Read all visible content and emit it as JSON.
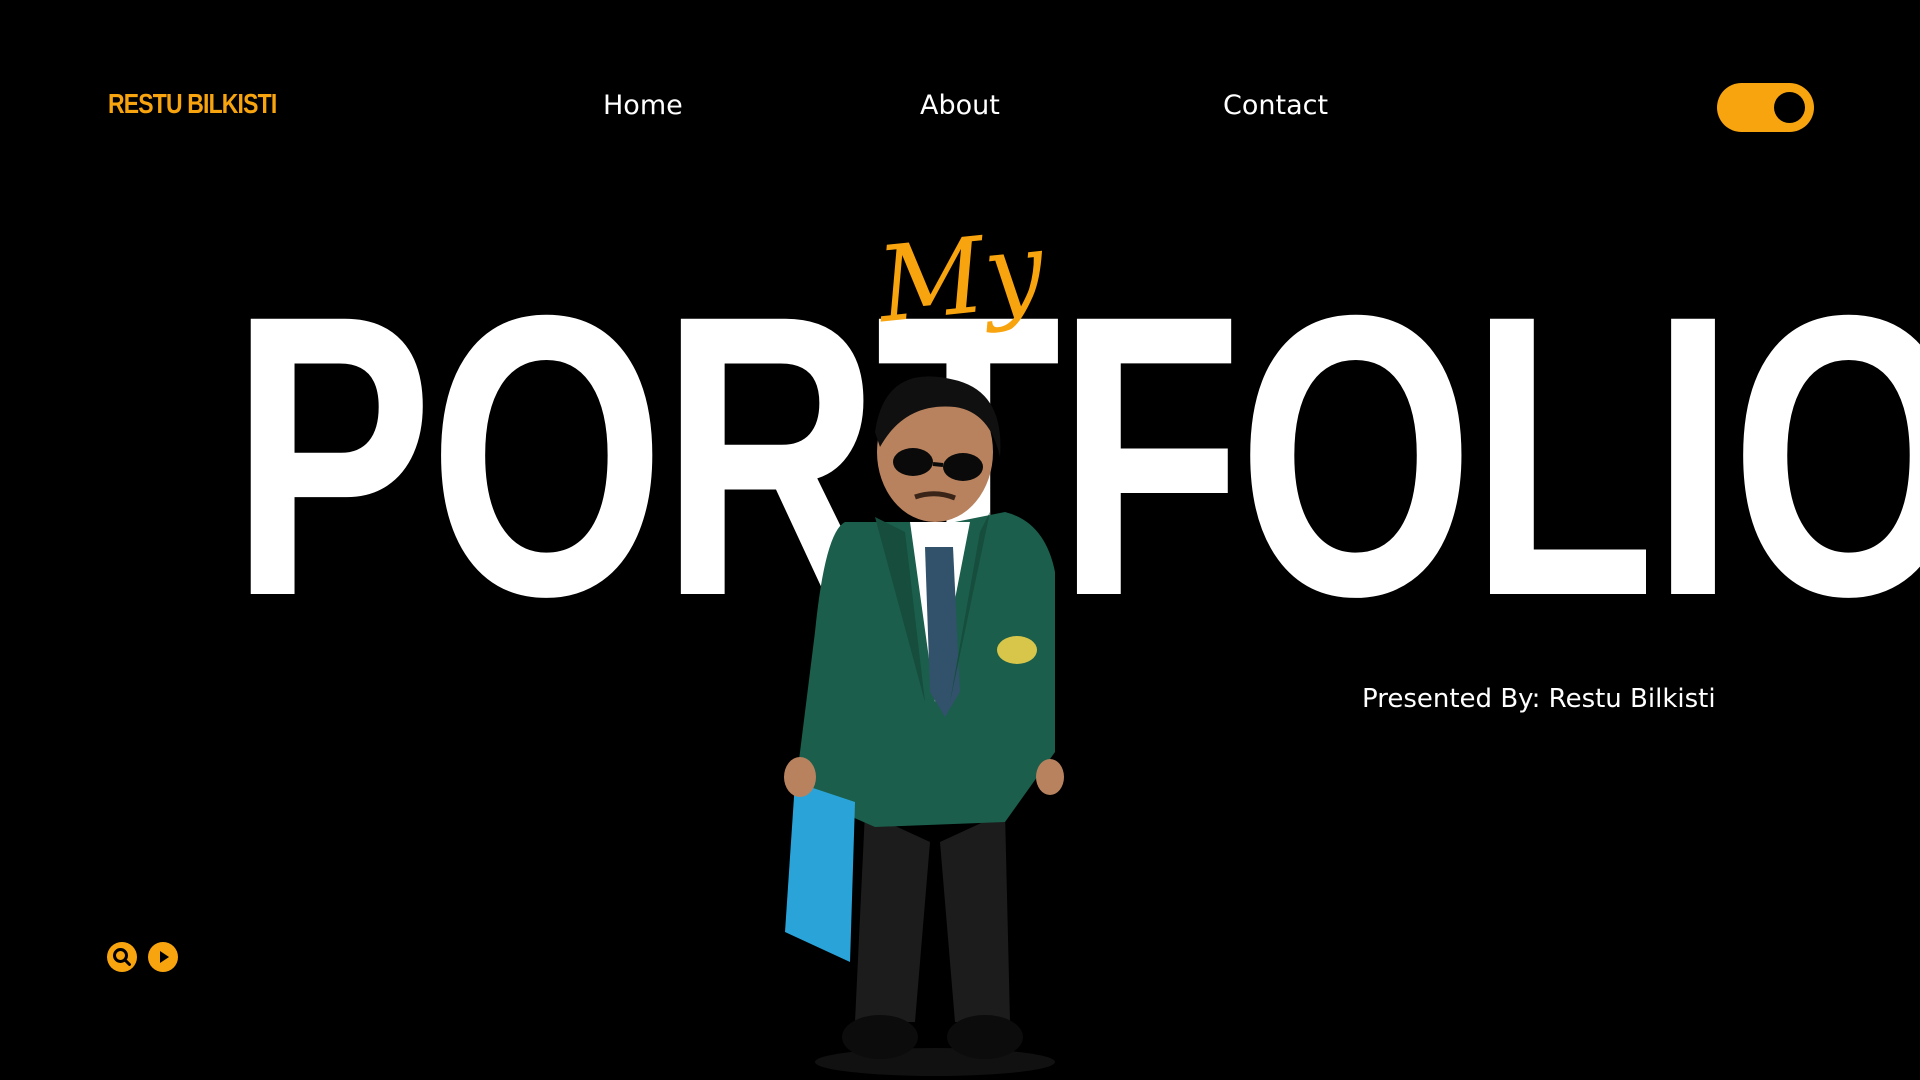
{
  "header": {
    "brand": "RESTU BILKISTI",
    "nav": {
      "home": "Home",
      "about": "About",
      "contact": "Contact"
    },
    "theme_toggle": {
      "icon": "toggle-switch-icon",
      "state": "on"
    }
  },
  "hero": {
    "script_title": "My",
    "title": "PORTFOLIO",
    "presented_by": "Presented By: Restu Bilkisti"
  },
  "footer_icons": [
    {
      "icon": "search-icon"
    },
    {
      "icon": "play-icon"
    }
  ],
  "colors": {
    "accent": "#f7a40f",
    "background": "#000000",
    "text": "#ffffff",
    "jacket": "#1b5e4b"
  }
}
